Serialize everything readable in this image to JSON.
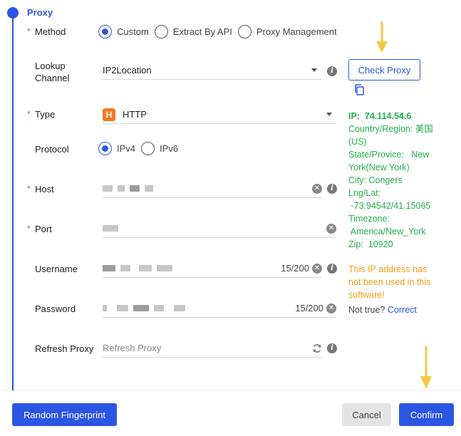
{
  "section": {
    "title": "Proxy"
  },
  "method": {
    "label": "Method",
    "options": [
      {
        "label": "Custom",
        "selected": true
      },
      {
        "label": "Extract By API",
        "selected": false
      },
      {
        "label": "Proxy Management",
        "selected": false
      }
    ]
  },
  "lookup": {
    "label_line1": "Lookup",
    "label_line2": "Channel",
    "value": "IP2Location"
  },
  "check_proxy": {
    "label": "Check Proxy"
  },
  "type": {
    "label": "Type",
    "badge": "H",
    "value": "HTTP"
  },
  "protocol": {
    "label": "Protocol",
    "options": [
      {
        "label": "IPv4",
        "selected": true
      },
      {
        "label": "IPv6",
        "selected": false
      }
    ]
  },
  "host": {
    "label": "Host"
  },
  "port": {
    "label": "Port"
  },
  "username": {
    "label": "Username",
    "counter": "15/200"
  },
  "password": {
    "label": "Password",
    "counter": "15/200"
  },
  "refresh": {
    "label": "Refresh Proxy",
    "placeholder": "Refresh Proxy"
  },
  "proxy_info": {
    "ip_label": "IP:",
    "ip_value": "74.114.54.6",
    "country_line1": "Country/Region:  美国",
    "country_line2": "(US)",
    "state_line1": "State/Provice:   New",
    "state_line2": "York(New York)",
    "city": "City: Congers",
    "lnglat_label": "Lng/Lat:",
    "lnglat_value": " -73.94542/41.15065",
    "timezone_label": "Timezone:",
    "timezone_value": " America/New_York",
    "zip": "Zip:  10920"
  },
  "warning": {
    "line1": "This IP address has",
    "line2": "not been used in this",
    "line3": "software!"
  },
  "not_true": {
    "text": "Not true?",
    "link": "Correct"
  },
  "footer": {
    "random_fingerprint": "Random Fingerprint",
    "cancel": "Cancel",
    "confirm": "Confirm"
  },
  "colors": {
    "primary": "#2b56e3",
    "success": "#22b14c",
    "warning": "#f39c12",
    "required": "#e5484d",
    "arrow": "#f5c842"
  },
  "icons": [
    "info-icon",
    "clear-icon",
    "refresh-icon",
    "copy-icon",
    "chevron-down-icon",
    "http-badge-icon"
  ]
}
